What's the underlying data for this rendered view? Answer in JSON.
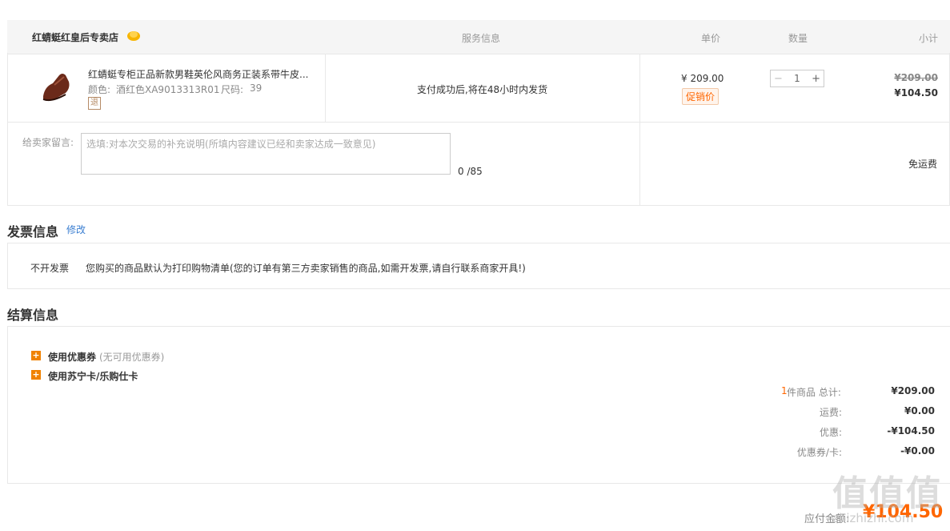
{
  "header": {
    "store_name": "红蜻蜓红皇后专卖店",
    "col_service": "服务信息",
    "col_price": "单价",
    "col_qty": "数量",
    "col_subtotal": "小计"
  },
  "product": {
    "title": "红蜻蜓专柜正品新款男鞋英伦风商务正装系带牛皮...",
    "color_label": "颜色:",
    "color_value": "酒红色XA9013313R01",
    "size_label": "尺码:",
    "size_value": "39",
    "return_tag": "退",
    "service": "支付成功后,将在48小时内发货",
    "price": "¥ 209.00",
    "promo_tag": "促销价",
    "qty_minus": "−",
    "qty": "1",
    "qty_plus": "+",
    "original_subtotal": "¥209.00",
    "subtotal": "¥104.50"
  },
  "message": {
    "label": "给卖家留言:",
    "placeholder": "选填:对本次交易的补充说明(所填内容建议已经和卖家达成一致意见)",
    "counter": "0 /85",
    "shipping": "免运费"
  },
  "invoice": {
    "title": "发票信息",
    "edit_link": "修改",
    "type": "不开发票",
    "note": "您购买的商品默认为打印购物清单(您的订单有第三方卖家销售的商品,如需开发票,请自行联系商家开具!)"
  },
  "settlement": {
    "title": "结算信息",
    "coupon_label": "使用优惠券",
    "coupon_note": "(无可用优惠券)",
    "card_label": "使用苏宁卡/乐购仕卡",
    "item_count": "1",
    "total_label": "件商品 总计:",
    "total_value": "¥209.00",
    "shipping_label": "运费:",
    "shipping_value": "¥0.00",
    "discount_label": "优惠:",
    "discount_value": "-¥104.50",
    "coupon_card_label": "优惠券/卡:",
    "coupon_card_value": "-¥0.00",
    "payable_label": "应付金额:",
    "payable_value": "¥104.50"
  },
  "watermark": "值值值",
  "watermark_sub": "zhizhizhi.com",
  "colors": {
    "accent": "#ff6600",
    "plus_icon": "#f08200",
    "link": "#3a7ed1"
  }
}
